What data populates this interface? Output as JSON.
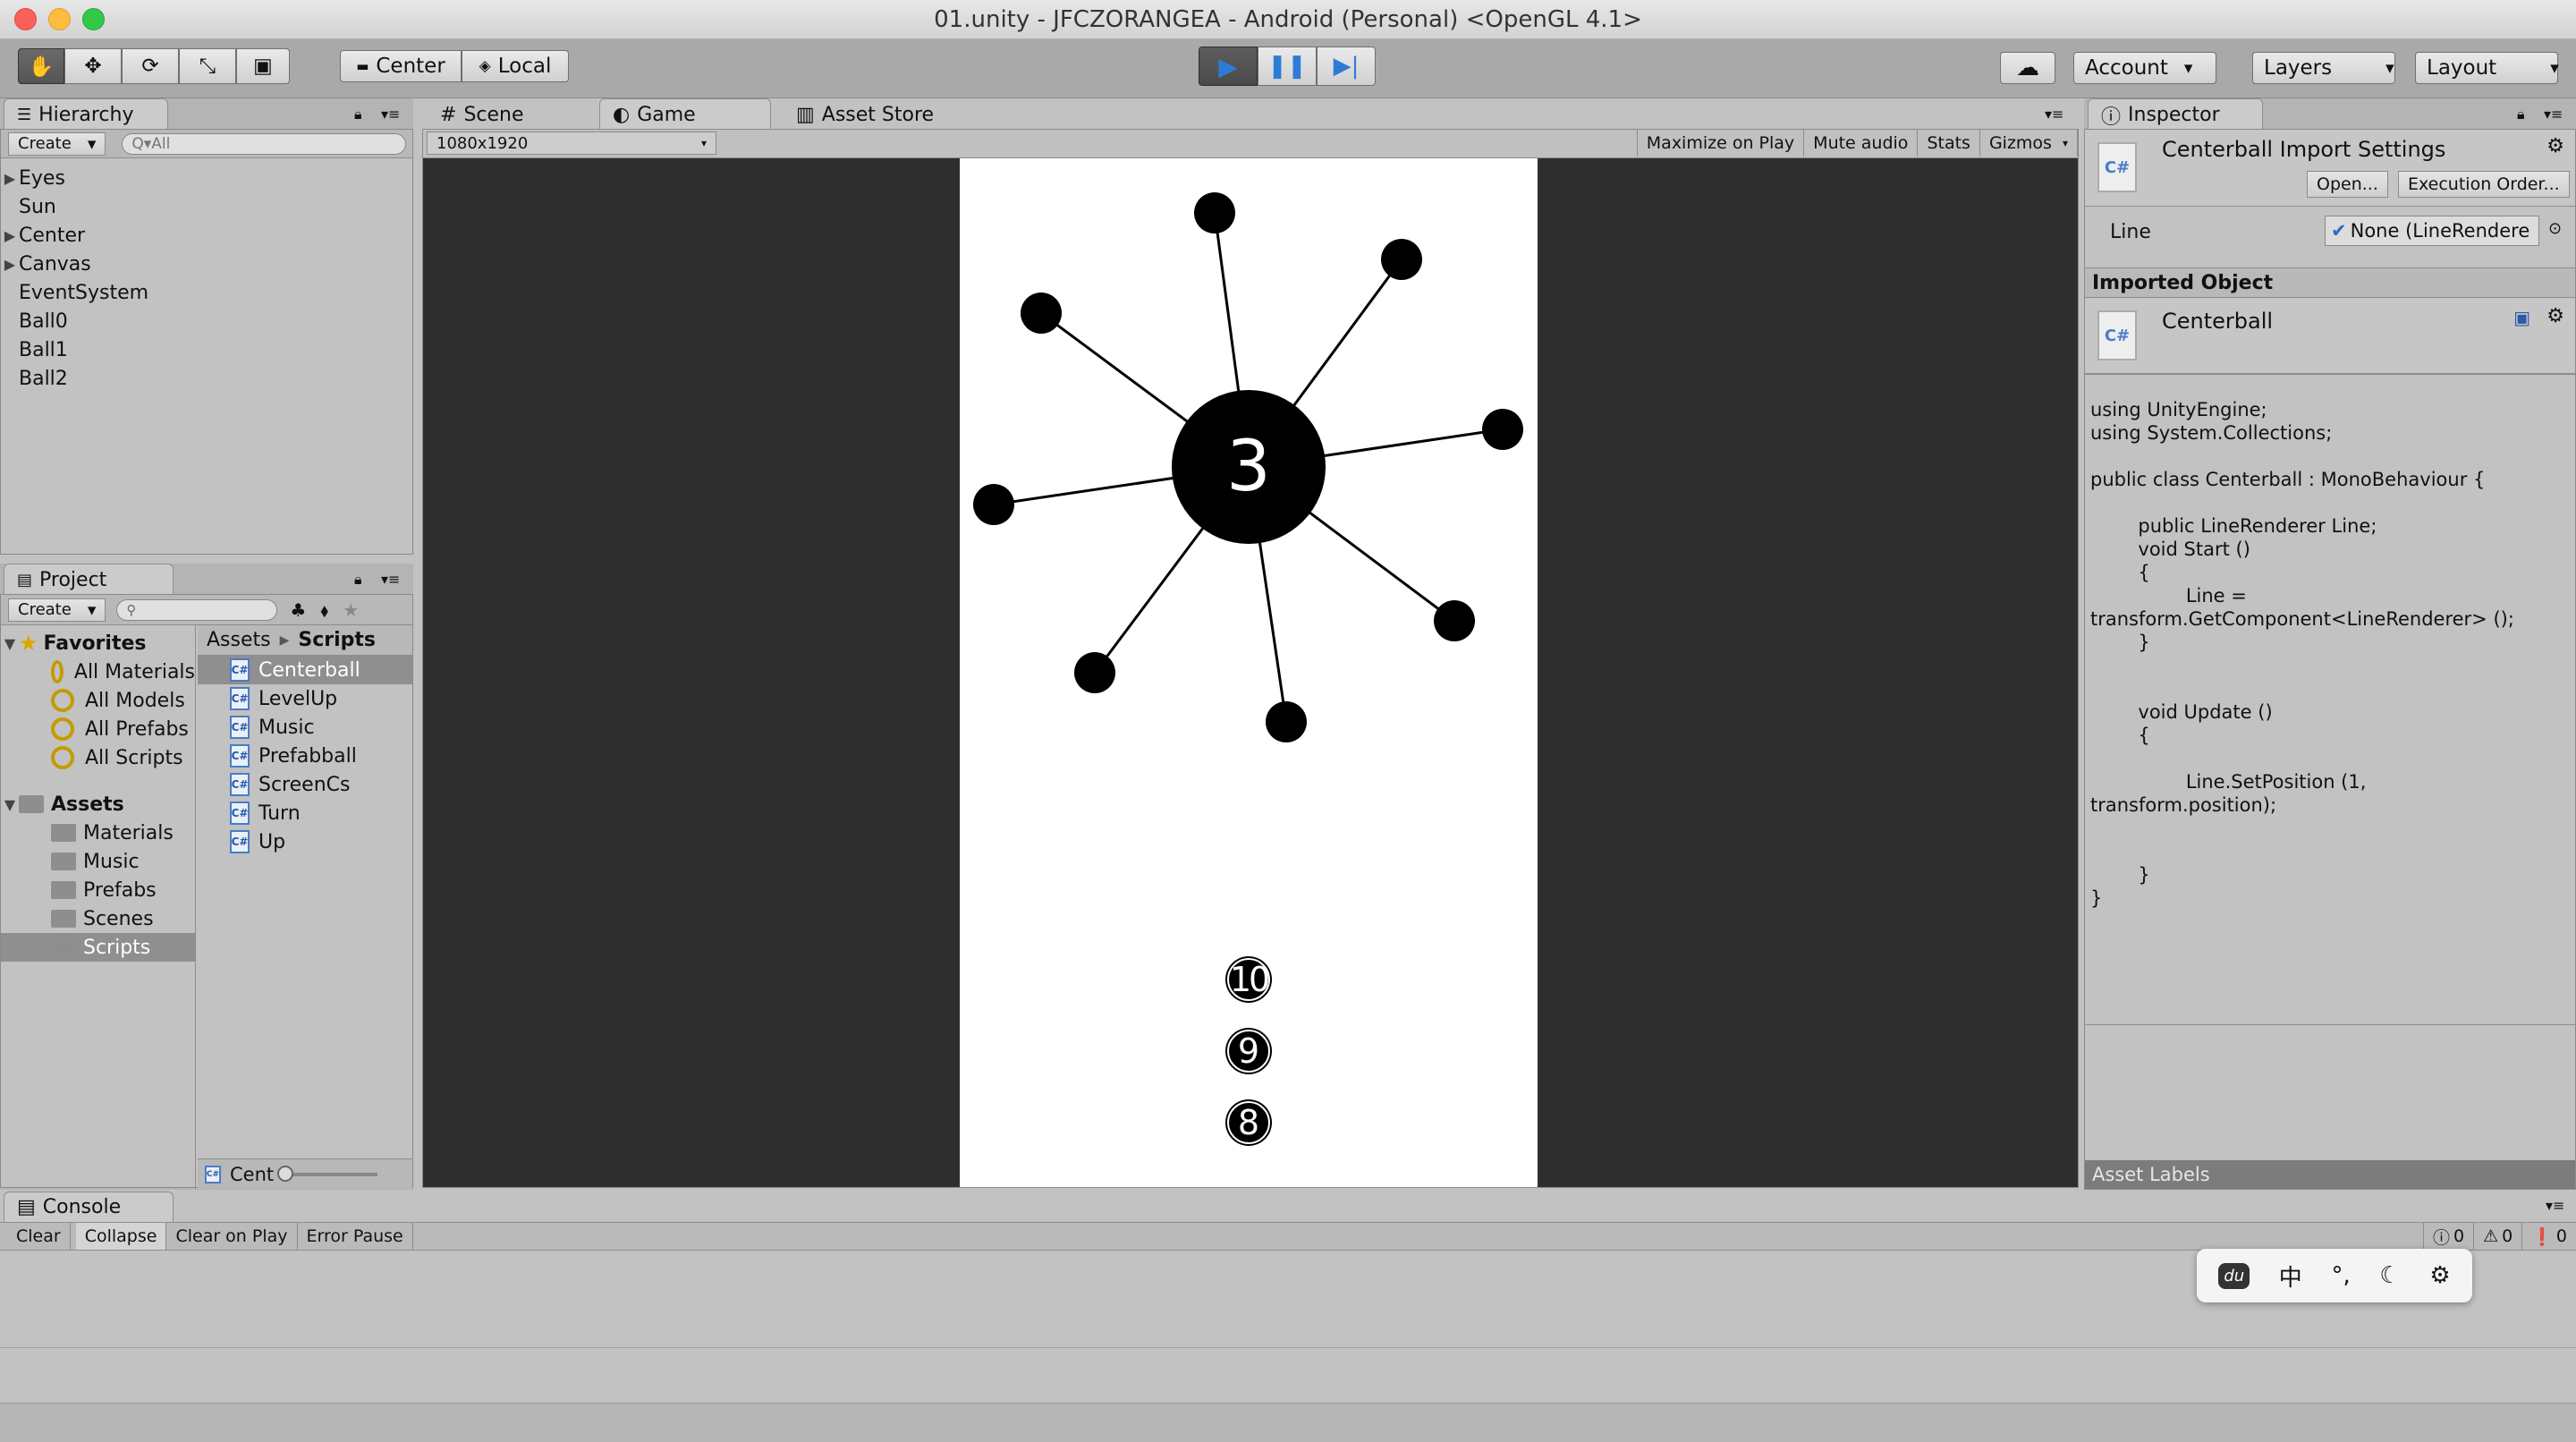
{
  "window": {
    "title": "01.unity - JFCZORANGEA - Android (Personal) <OpenGL 4.1>"
  },
  "toolbar": {
    "tools": [
      "hand-icon",
      "move-icon",
      "rotate-icon",
      "scale-icon",
      "rect-icon"
    ],
    "pivot_label": "Center",
    "space_label": "Local",
    "account_label": "Account",
    "layers_label": "Layers",
    "layout_label": "Layout",
    "play_accent": "#2e7bd6"
  },
  "hierarchy": {
    "tab_label": "Hierarchy",
    "create_label": "Create",
    "search_placeholder": "Q▾All",
    "items": [
      {
        "label": "Eyes",
        "expandable": true
      },
      {
        "label": "Sun",
        "expandable": false
      },
      {
        "label": "Center",
        "expandable": true
      },
      {
        "label": "Canvas",
        "expandable": true
      },
      {
        "label": "EventSystem",
        "expandable": false
      },
      {
        "label": "Ball0",
        "expandable": false
      },
      {
        "label": "Ball1",
        "expandable": false
      },
      {
        "label": "Ball2",
        "expandable": false
      }
    ]
  },
  "project": {
    "tab_label": "Project",
    "create_label": "Create",
    "favorites_label": "Favorites",
    "favorites": [
      "All Materials",
      "All Models",
      "All Prefabs",
      "All Scripts"
    ],
    "assets_label": "Assets",
    "asset_folders": [
      "Materials",
      "Music",
      "Prefabs",
      "Scenes",
      "Scripts"
    ],
    "breadcrumb": [
      "Assets",
      "Scripts"
    ],
    "files": [
      "Centerball",
      "LevelUp",
      "Music",
      "Prefabball",
      "ScreenCs",
      "Turn",
      "Up"
    ],
    "selected_file": "Centerball",
    "bottom_label": "Cent"
  },
  "center_tabs": {
    "scene": "Scene",
    "game": "Game",
    "asset_store": "Asset Store"
  },
  "game": {
    "resolution": "1080x1920",
    "maximize_label": "Maximize on Play",
    "mute_label": "Mute audio",
    "stats_label": "Stats",
    "gizmos_label": "Gizmos",
    "center_number": "3",
    "queue_numbers": [
      "10",
      "9",
      "8"
    ]
  },
  "inspector": {
    "tab_label": "Inspector",
    "title": "Centerball Import Settings",
    "open_label": "Open...",
    "exec_label": "Execution Order...",
    "line_label": "Line",
    "line_value": "None (LineRendere",
    "imported_label": "Imported Object",
    "object_name": "Centerball",
    "code": "using UnityEngine;\nusing System.Collections;\n\npublic class Centerball : MonoBehaviour {\n\n\t\tpublic LineRenderer Line;\n\t\tvoid Start ()\n\t\t{\n\t\t\t\tLine =\ntransform.GetComponent<LineRenderer> ();\n\t\t}\n\n\n\t\tvoid Update ()\n\t\t{\n\n\t\t\t\tLine.SetPosition (1,\ntransform.position);\n\n\n\t\t}\n}",
    "asset_labels": "Asset Labels"
  },
  "console": {
    "tab_label": "Console",
    "clear": "Clear",
    "collapse": "Collapse",
    "clear_on_play": "Clear on Play",
    "error_pause": "Error Pause",
    "info_count": "0",
    "warn_count": "0",
    "error_count": "0"
  },
  "ime": {
    "items": [
      "du",
      "中",
      "°,",
      "moon-icon",
      "gear-icon"
    ]
  }
}
